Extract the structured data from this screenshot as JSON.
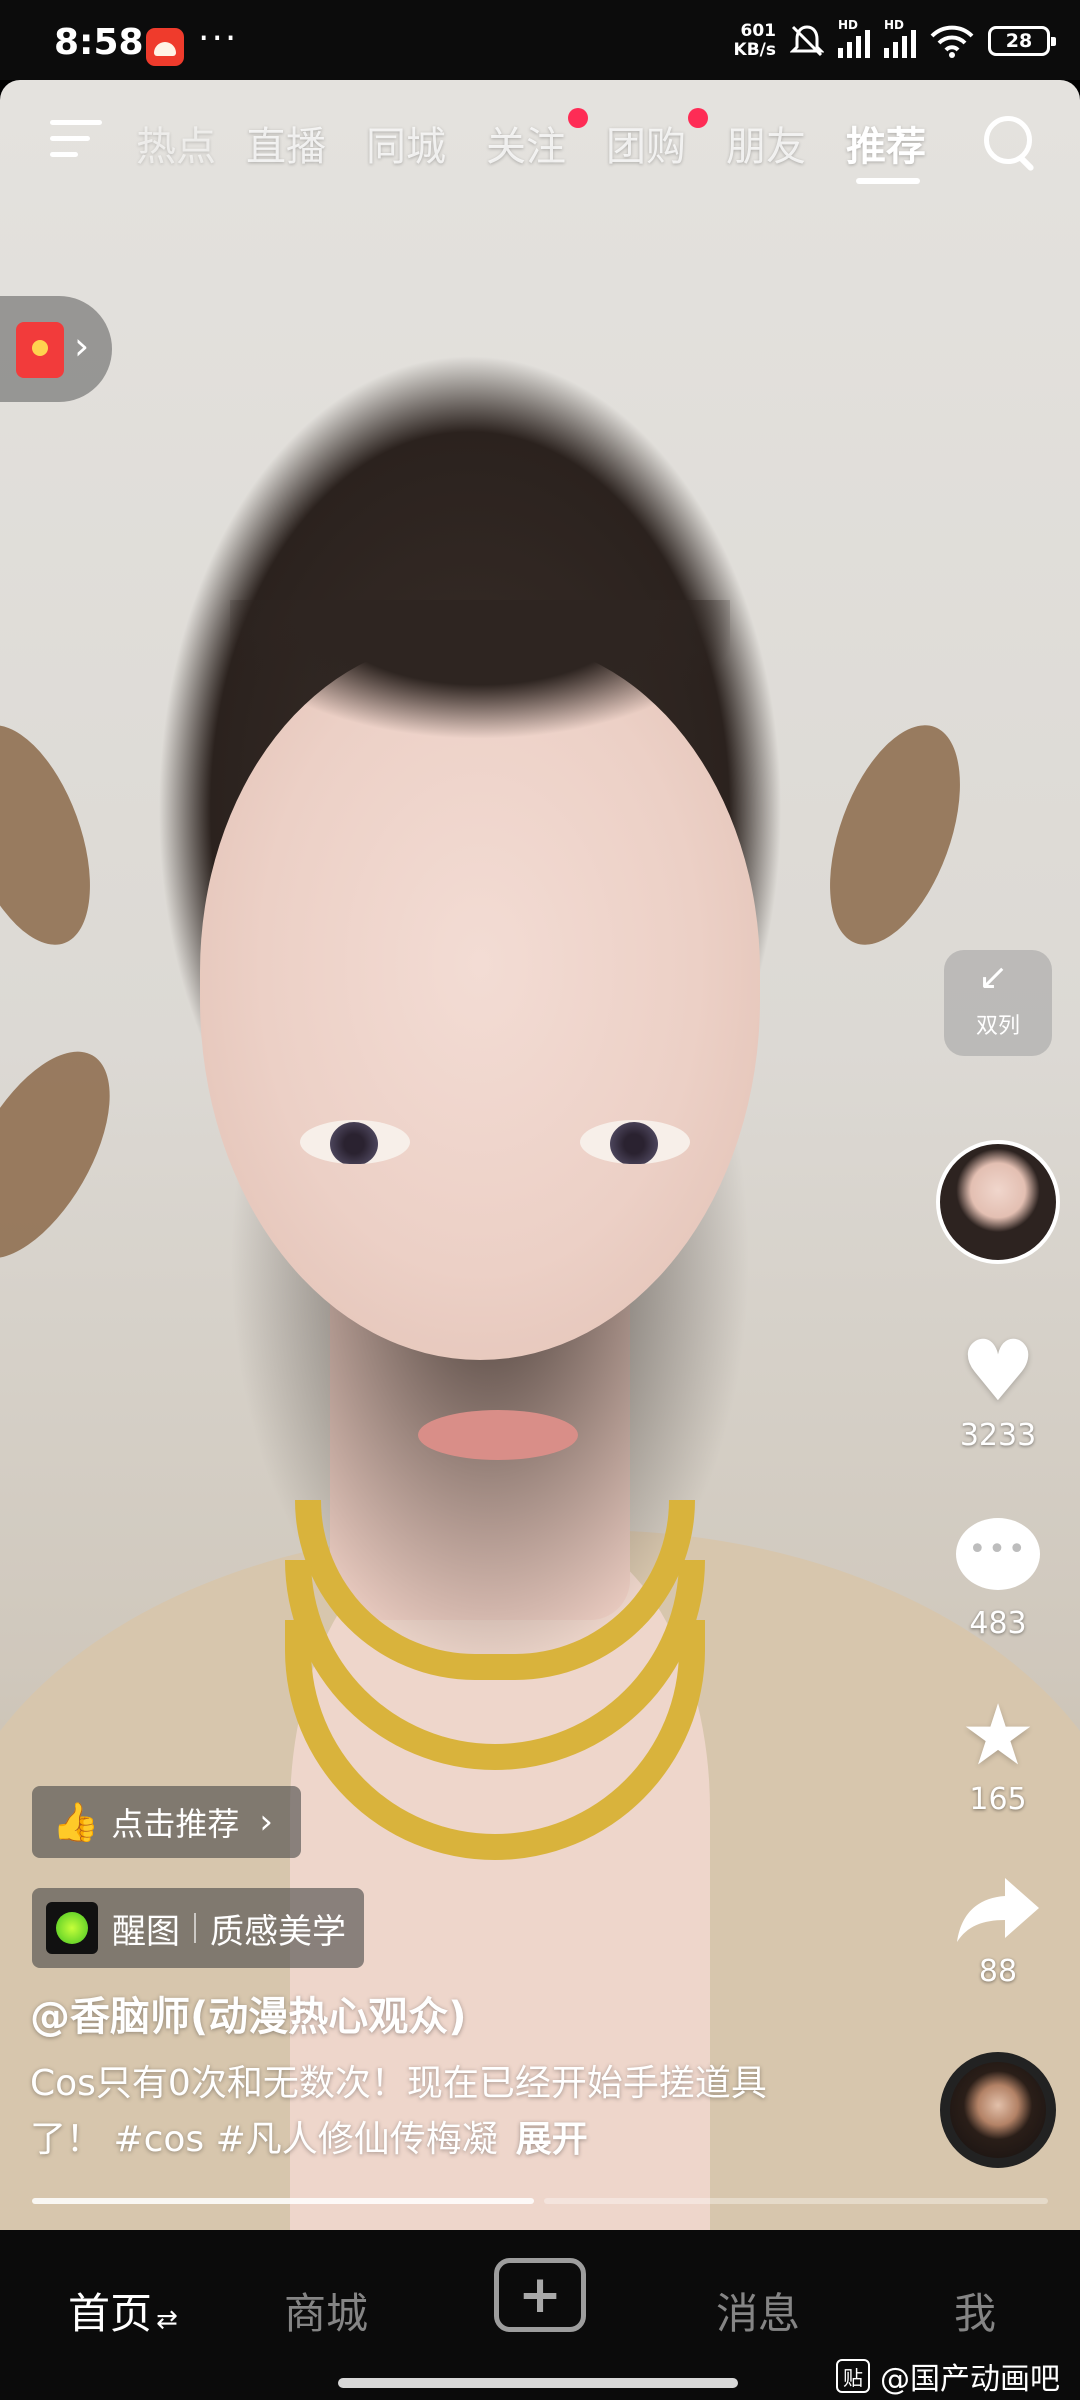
{
  "status_bar": {
    "time": "8:58",
    "dots": "···",
    "net_speed_value": "601",
    "net_speed_unit": "KB/s",
    "hd_label": "HD",
    "battery": "28"
  },
  "top_nav": {
    "tabs": [
      {
        "label": "热点",
        "badge": false,
        "active": false
      },
      {
        "label": "直播",
        "badge": false,
        "active": false
      },
      {
        "label": "同城",
        "badge": false,
        "active": false
      },
      {
        "label": "关注",
        "badge": true,
        "active": false
      },
      {
        "label": "团购",
        "badge": true,
        "active": false
      },
      {
        "label": "朋友",
        "badge": false,
        "active": false
      },
      {
        "label": "推荐",
        "badge": false,
        "active": true
      }
    ],
    "icons": [
      "menu-icon",
      "search-icon"
    ]
  },
  "side": {
    "dual_column_label": "双列",
    "likes": "3233",
    "comments": "483",
    "favorites": "165",
    "shares": "88"
  },
  "overlay": {
    "recommend_label": "点击推荐",
    "effect_name": "醒图",
    "effect_tag": "质感美学",
    "author": "@香脑师(动漫热心观众)",
    "caption_line1": "Cos只有0次和无数次！现在已经开始手搓道具",
    "caption_line2": "了！ #cos #凡人修仙传梅凝",
    "expand_label": "展开",
    "progress_fraction": 0.5
  },
  "bottom_nav": {
    "home": "首页",
    "mall": "商城",
    "add": "+",
    "messages": "消息",
    "me": "我"
  },
  "watermark": {
    "icon_text": "贴",
    "text": "@国产动画吧"
  },
  "colors": {
    "badge_red": "#fe2c55",
    "bar_bg": "#0b0b0b"
  }
}
